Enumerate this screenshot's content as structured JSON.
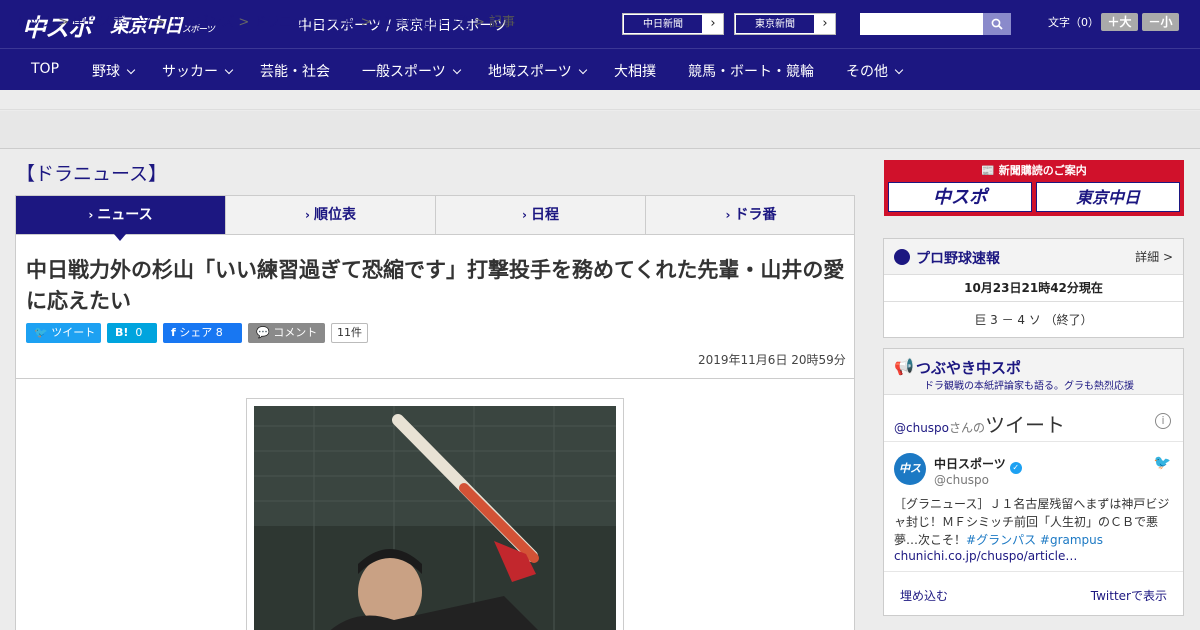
{
  "header": {
    "logo_main": "中スポ",
    "logo_tokyo": "東京中日",
    "logo_tokyo_small": "スポーツ",
    "site_title": "中日スポーツ / 東京中日スポーツ",
    "ext_links": [
      "中日新聞",
      "東京新聞"
    ],
    "search_placeholder": "",
    "font_size_label": "文字（0）",
    "font_larger": "＋大",
    "font_smaller": "－小"
  },
  "nav": [
    "TOP",
    "野球",
    "サッカー",
    "芸能・社会",
    "一般スポーツ",
    "地域スポーツ",
    "大相撲",
    "競馬・ボート・競輪",
    "その他"
  ],
  "breadcrumbs": [
    "トップ",
    "中日スポーツ",
    "ドラゴンズ",
    "ドラニュース一覧",
    "11月の記事一覧",
    "記事"
  ],
  "section_title": "【ドラニュース】",
  "tabs": [
    "ニュース",
    "順位表",
    "日程",
    "ドラ番"
  ],
  "article": {
    "headline": "中日戦力外の杉山「いい練習過ぎて恐縮です」打撃投手を務めてくれた先輩・山井の愛に応えたい",
    "share": {
      "tweet": "ツイート",
      "hatena_label": "B!",
      "hatena_count": "0",
      "facebook": "シェア",
      "facebook_count": "8",
      "comment": "コメント",
      "comment_count": "11件"
    },
    "date": "2019年11月6日 20時59分"
  },
  "sidebar": {
    "ad_title": "新聞購読のご案内",
    "ad_logos": [
      "中スポ",
      "東京中日"
    ],
    "baseball": {
      "title": "プロ野球速報",
      "more": "詳細 >",
      "time": "10月23日21時42分現在",
      "score": "巨 3 － 4 ソ （終了）"
    },
    "twitter": {
      "title": "つぶやき中スポ",
      "subtitle": "ドラ観戦の本紙評論家も語る。グラも熱烈応援",
      "user_handle_prefix": "@chuspo",
      "user_suffix": "さんの",
      "tweets_word": "ツイート",
      "name": "中日スポーツ",
      "handle": "@chuspo",
      "text": "［グラニュース］Ｊ１名古屋残留へまずは神戸ビジャ封じ！ＭＦシミッチ前回「人生初」のＣＢで悪夢…次こそ！",
      "tag1": "#グランパス",
      "tag2": "#grampus",
      "link": "chunichi.co.jp/chuspo/article…",
      "embed": "埋め込む",
      "view_on": "Twitterで表示"
    }
  },
  "colors": {
    "brand_navy": "#1c1781",
    "twitter_blue": "#1da1f2",
    "facebook_blue": "#1877f2",
    "ad_red": "#d0112b"
  }
}
